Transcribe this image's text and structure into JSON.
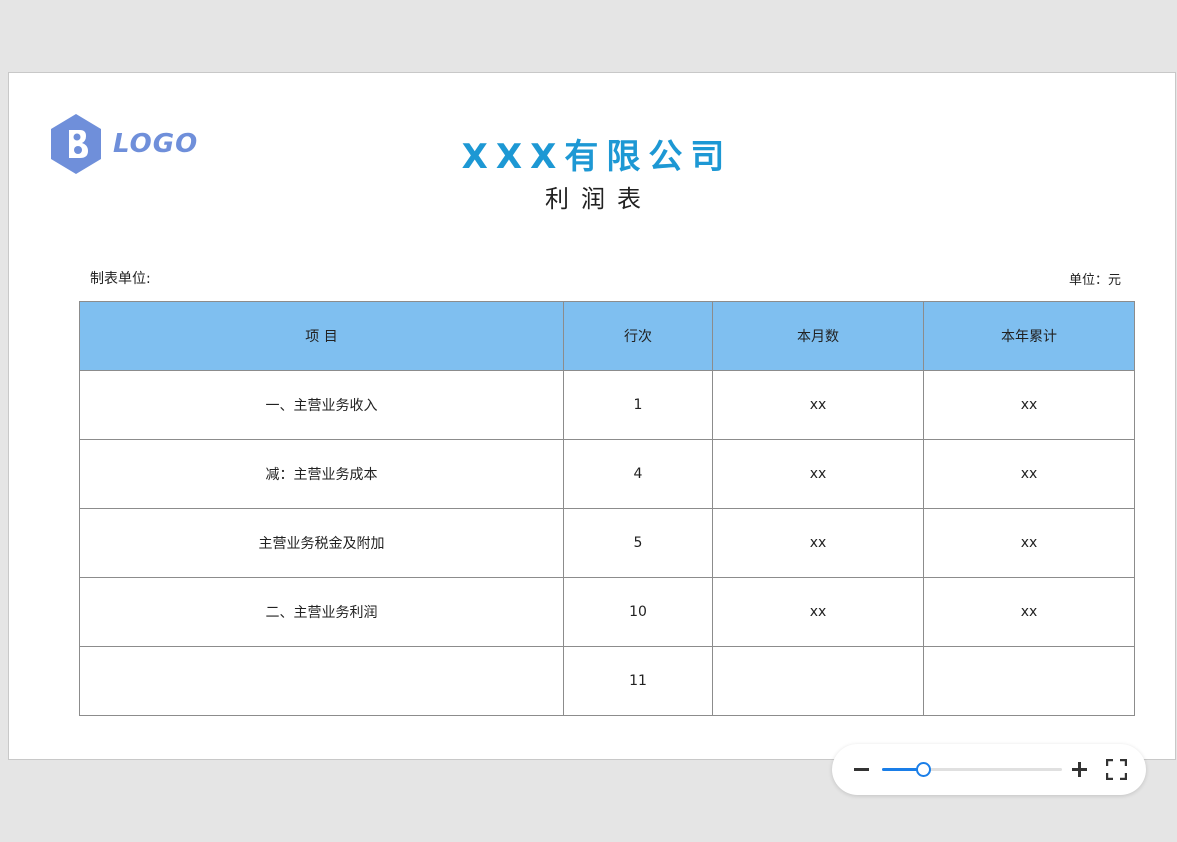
{
  "logo": {
    "text": "LOGO"
  },
  "header": {
    "company": "XXX有限公司",
    "report_title": "利润表"
  },
  "meta": {
    "prepared_by_label": "制表单位:",
    "unit_label": "单位：元"
  },
  "table": {
    "headers": [
      "项 目",
      "行次",
      "本月数",
      "本年累计"
    ],
    "rows": [
      {
        "item": "一、主营业务收入",
        "line": "1",
        "month": "xx",
        "year": "xx"
      },
      {
        "item": "减：主营业务成本",
        "line": "4",
        "month": "xx",
        "year": "xx"
      },
      {
        "item": "主营业务税金及附加",
        "line": "5",
        "month": "xx",
        "year": "xx"
      },
      {
        "item": "二、主营业务利润",
        "line": "10",
        "month": "xx",
        "year": "xx"
      },
      {
        "item": "",
        "line": "11",
        "month": "",
        "year": ""
      }
    ]
  },
  "zoom": {
    "level_fraction": 0.23
  },
  "icons": {
    "logo": "hexagon-logo-icon",
    "zoom_out": "minus-icon",
    "zoom_in": "plus-icon",
    "fullscreen": "fullscreen-icon"
  },
  "colors": {
    "company_title": "#1d98d4",
    "header_fill": "#7fbff0",
    "logo": "#6f8fda",
    "accent": "#1a7ee8"
  }
}
